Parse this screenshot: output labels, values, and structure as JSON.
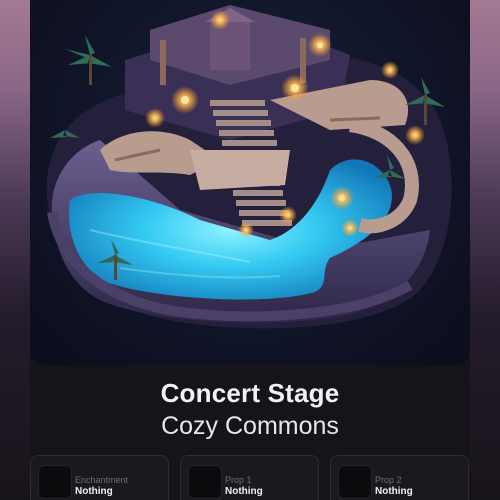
{
  "item": {
    "name": "Concert Stage",
    "collection": "Cozy Commons"
  },
  "slots": [
    {
      "label": "Enchantment",
      "value": "Nothing"
    },
    {
      "label": "Prop 1",
      "value": "Nothing"
    },
    {
      "label": "Prop 2",
      "value": "Nothing"
    }
  ],
  "colors": {
    "water": "#3fd4ff",
    "stone": "#5a4f78",
    "lantern": "#ffc25a",
    "background": "#16141a"
  }
}
